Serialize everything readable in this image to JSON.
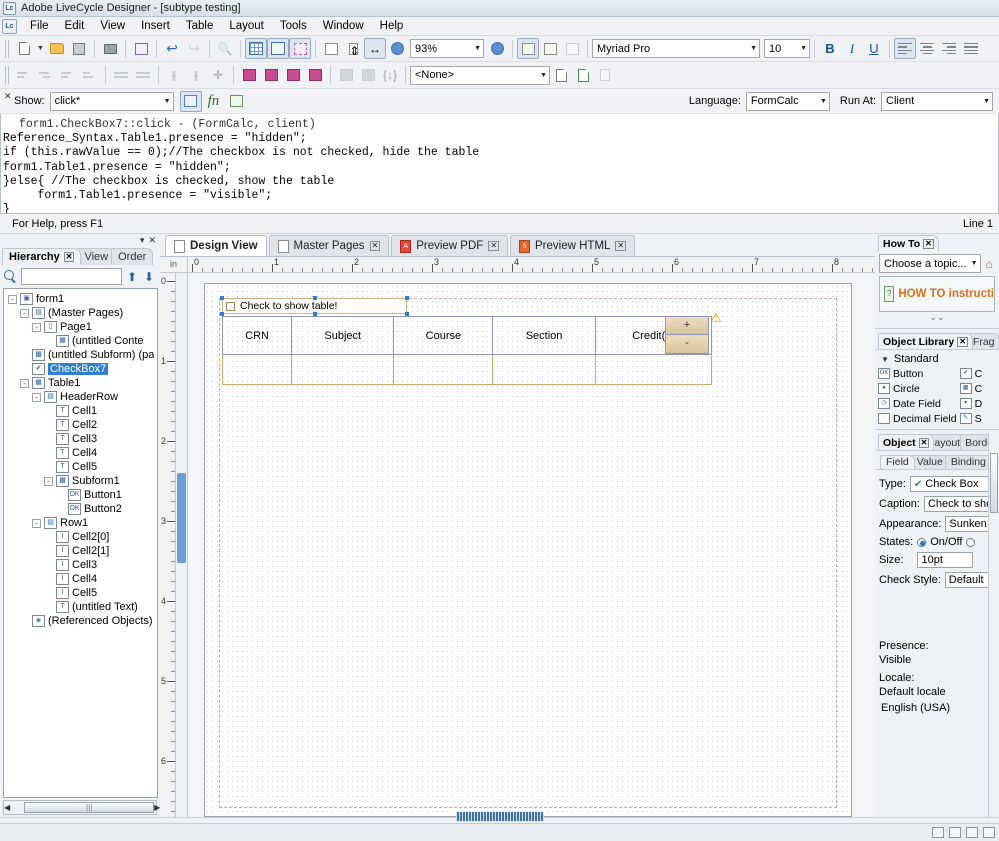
{
  "window": {
    "title": "Adobe LiveCycle Designer - [subtype testing]",
    "app_icon": "lc"
  },
  "menubar": {
    "items": [
      "File",
      "Edit",
      "View",
      "Insert",
      "Table",
      "Layout",
      "Tools",
      "Window",
      "Help"
    ]
  },
  "toolbar": {
    "zoom_value": "93%",
    "font_family": "Myriad Pro",
    "font_size": "10",
    "bold_label": "B",
    "italic_label": "I",
    "underline_label": "U",
    "style_value": "<None>",
    "icons": [
      "new-document-icon",
      "open-folder-icon",
      "save-icon",
      "print-icon",
      "print-preview-icon",
      "undo-icon",
      "redo-icon",
      "find-icon",
      "grid-icon",
      "grid-color-icon",
      "selection-icon",
      "page-icon",
      "fit-height-icon",
      "fit-width-icon",
      "zoom-out-icon",
      "zoom-in-icon",
      "form-properties-icon",
      "spellcheck-icon",
      "image-icon"
    ]
  },
  "script_editor": {
    "show_label": "Show:",
    "show_value": "click*",
    "language_label": "Language:",
    "language_value": "FormCalc",
    "run_at_label": "Run At:",
    "run_at_value": "Client",
    "header": "form1.CheckBox7::click - (FormCalc, client)",
    "lines": [
      "Reference_Syntax.Table1.presence = \"hidden\";",
      "if (this.rawValue == 0);//The checkbox is not checked, hide the table",
      "form1.Table1.presence = \"hidden\";",
      "}else{ //The checkbox is checked, show the table",
      "     form1.Table1.presence = \"visible\";",
      "}"
    ]
  },
  "statusbar": {
    "help_text": "For Help, press F1",
    "line_text": "Line 1"
  },
  "hierarchy_panel": {
    "tabs": [
      {
        "label": "Hierarchy",
        "active": true,
        "closable": true
      },
      {
        "label": "View",
        "active": false,
        "closable": false
      },
      {
        "label": "Order",
        "active": false,
        "closable": false
      }
    ],
    "search_placeholder": "",
    "search_value": "",
    "tree": [
      {
        "label": "form1",
        "depth": 0,
        "expander": "-",
        "icon": "form-icon",
        "selected": false
      },
      {
        "label": "(Master Pages)",
        "depth": 1,
        "expander": "-",
        "icon": "masterpages-icon",
        "selected": false
      },
      {
        "label": "Page1",
        "depth": 2,
        "expander": "-",
        "icon": "page-icon",
        "selected": false
      },
      {
        "label": "(untitled Conte",
        "depth": 3,
        "expander": "",
        "icon": "content-area-icon",
        "selected": false
      },
      {
        "label": "(untitled Subform) (pa",
        "depth": 1,
        "expander": "",
        "icon": "subform-icon",
        "selected": false
      },
      {
        "label": "CheckBox7",
        "depth": 1,
        "expander": "",
        "icon": "checkbox-icon",
        "selected": true
      },
      {
        "label": "Table1",
        "depth": 1,
        "expander": "-",
        "icon": "table-icon",
        "selected": false
      },
      {
        "label": "HeaderRow",
        "depth": 2,
        "expander": "-",
        "icon": "header-row-icon",
        "selected": false
      },
      {
        "label": "Cell1",
        "depth": 3,
        "expander": "",
        "icon": "text-icon",
        "selected": false
      },
      {
        "label": "Cell2",
        "depth": 3,
        "expander": "",
        "icon": "text-icon",
        "selected": false
      },
      {
        "label": "Cell3",
        "depth": 3,
        "expander": "",
        "icon": "text-icon",
        "selected": false
      },
      {
        "label": "Cell4",
        "depth": 3,
        "expander": "",
        "icon": "text-icon",
        "selected": false
      },
      {
        "label": "Cell5",
        "depth": 3,
        "expander": "",
        "icon": "text-icon",
        "selected": false
      },
      {
        "label": "Subform1",
        "depth": 3,
        "expander": "-",
        "icon": "subform-icon",
        "selected": false
      },
      {
        "label": "Button1",
        "depth": 4,
        "expander": "",
        "icon": "button-icon",
        "selected": false
      },
      {
        "label": "Button2",
        "depth": 4,
        "expander": "",
        "icon": "button-icon",
        "selected": false
      },
      {
        "label": "Row1",
        "depth": 2,
        "expander": "-",
        "icon": "row-icon",
        "selected": false
      },
      {
        "label": "Cell2[0]",
        "depth": 3,
        "expander": "",
        "icon": "field-icon",
        "selected": false
      },
      {
        "label": "Cell2[1]",
        "depth": 3,
        "expander": "",
        "icon": "field-icon",
        "selected": false
      },
      {
        "label": "Cell3",
        "depth": 3,
        "expander": "",
        "icon": "field-icon",
        "selected": false
      },
      {
        "label": "Cell4",
        "depth": 3,
        "expander": "",
        "icon": "field-icon",
        "selected": false
      },
      {
        "label": "Cell5",
        "depth": 3,
        "expander": "",
        "icon": "field-icon",
        "selected": false
      },
      {
        "label": "(untitled Text)",
        "depth": 3,
        "expander": "",
        "icon": "text-icon",
        "selected": false
      },
      {
        "label": "(Referenced Objects)",
        "depth": 1,
        "expander": "",
        "icon": "referenced-objects-icon",
        "selected": false
      }
    ]
  },
  "document_tabs": [
    {
      "label": "Design View",
      "active": true,
      "closable": false,
      "icon": "page-icon"
    },
    {
      "label": "Master Pages",
      "active": false,
      "closable": true,
      "icon": "page-icon"
    },
    {
      "label": "Preview PDF",
      "active": false,
      "closable": true,
      "icon": "pdf-icon"
    },
    {
      "label": "Preview HTML",
      "active": false,
      "closable": true,
      "icon": "html-icon"
    }
  ],
  "rulers": {
    "horizontal_labels": [
      "0",
      "1",
      "2",
      "3",
      "4",
      "5",
      "6",
      "7",
      "8"
    ],
    "vertical_labels": [
      "0",
      "1",
      "2",
      "3",
      "4",
      "5",
      "6"
    ],
    "corner_unit": "in"
  },
  "canvas": {
    "checkbox": {
      "caption": "Check to show table!",
      "checked": false
    },
    "table": {
      "headers": [
        "CRN",
        "Subject",
        "Course",
        "Section",
        "Credit(s)"
      ],
      "body_row": [
        "",
        "",
        "",
        "",
        ""
      ],
      "add_button_label": "+",
      "remove_button_label": "-",
      "warning_icon": "warning-icon"
    }
  },
  "how_to_panel": {
    "tab_label": "How To",
    "topic_value": "Choose a topic...",
    "instruction_text": "HOW TO instructi",
    "home_icon": "home-icon"
  },
  "object_library": {
    "tabs": [
      {
        "label": "Object Library",
        "active": true,
        "closable": true
      },
      {
        "label": "Frag",
        "active": false,
        "closable": false
      }
    ],
    "group_label": "Standard",
    "column1": [
      {
        "label": "Button",
        "icon": "button-icon"
      },
      {
        "label": "Circle",
        "icon": "circle-icon"
      },
      {
        "label": "Date Field",
        "icon": "date-field-icon"
      },
      {
        "label": "Decimal Field",
        "icon": "decimal-field-icon"
      }
    ],
    "column2": [
      {
        "label": "C",
        "icon": "checkbox-icon"
      },
      {
        "label": "C",
        "icon": "content-area-icon"
      },
      {
        "label": "D",
        "icon": "drop-down-icon"
      },
      {
        "label": "S",
        "icon": "signature-icon"
      }
    ]
  },
  "object_panel": {
    "tabs": [
      {
        "label": "Object",
        "active": true,
        "closable": true
      },
      {
        "label": "ayout",
        "active": false,
        "closable": false
      },
      {
        "label": "Border",
        "active": false,
        "closable": false
      }
    ],
    "field_tabs": [
      {
        "label": "Field",
        "active": true
      },
      {
        "label": "Value",
        "active": false
      },
      {
        "label": "Binding",
        "active": false
      }
    ],
    "rows": [
      {
        "label": "Type:",
        "value": "Check Box",
        "kind": "combo-icon",
        "icon": "checkbox-icon"
      },
      {
        "label": "Caption:",
        "value": "Check to show",
        "kind": "input"
      },
      {
        "label": "Appearance:",
        "value": "Sunken Square",
        "kind": "combo"
      },
      {
        "label": "States:",
        "value": "On/Off",
        "kind": "radio"
      },
      {
        "label": "Size:",
        "value": "10pt",
        "kind": "input"
      },
      {
        "label": "Check Style:",
        "value": "Default",
        "kind": "combo"
      }
    ],
    "presence_label": "Presence:",
    "presence_value": "Visible",
    "locale_label": "Locale:",
    "locale_value": "Default locale",
    "locale_option": "English (USA)"
  }
}
